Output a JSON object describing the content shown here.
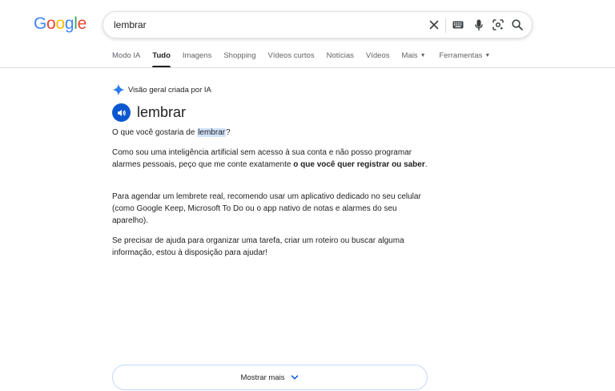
{
  "logo": {
    "text": "Google"
  },
  "search": {
    "query": "lembrar"
  },
  "tabs": [
    {
      "label": "Modo IA"
    },
    {
      "label": "Tudo",
      "active": true
    },
    {
      "label": "Imagens"
    },
    {
      "label": "Shopping"
    },
    {
      "label": "Vídeos curtos"
    },
    {
      "label": "Notícias"
    },
    {
      "label": "Vídeos"
    },
    {
      "label": "Mais",
      "dropdown": true
    },
    {
      "label": "Ferramentas",
      "dropdown": true
    }
  ],
  "ai_overview": {
    "header": "Visão geral criada por IA",
    "term": "lembrar",
    "p1_before": "O que você gostaria de",
    "p1_highlight": "lembrar",
    "p1_after": "?",
    "p2_text": "Como sou uma inteligência artificial sem acesso à sua conta e não posso programar alarmes pessoais, peço que me conte exatamente",
    "p2_bold": "o que você quer registrar ou saber",
    "p2_end": ".",
    "p3": "Para agendar um lembrete real, recomendo usar um aplicativo dedicado no seu celular (como Google Keep, Microsoft To Do ou o app nativo de notas e alarmes do seu aparelho).",
    "p4": "Se precisar de ajuda para organizar uma tarefa, criar um roteiro ou buscar alguma informação, estou à disposição para ajudar!"
  },
  "show_more": {
    "label": "Mostrar mais"
  },
  "colors": {
    "accent": "#0b57d0",
    "highlight": "#d3e3fd"
  }
}
